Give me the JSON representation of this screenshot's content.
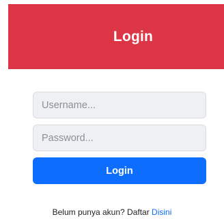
{
  "header": {
    "title": "Login",
    "color": "#dc3545"
  },
  "form": {
    "username_placeholder": "Username...",
    "username_value": "",
    "password_placeholder": "Password...",
    "password_value": "",
    "login_label": "Login",
    "button_color": "#0d6efd"
  },
  "register": {
    "prompt": "Belum punya akun? Daftar",
    "link_label": "Disini"
  }
}
